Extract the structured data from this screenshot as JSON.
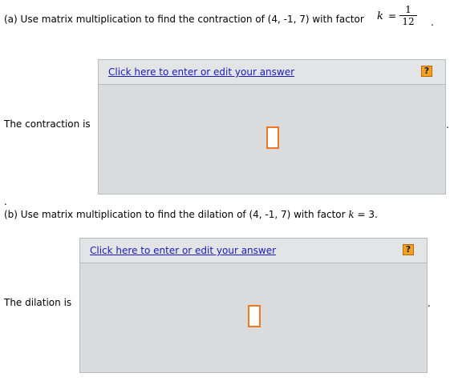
{
  "part_a": {
    "question": "(a) Use matrix multiplication to find the contraction of (4, -1, 7) with factor",
    "k_var": "k",
    "equals": "=",
    "frac_num": "1",
    "frac_den": "12",
    "end_mark": ".",
    "answer_label": "The contraction is",
    "link_text": "Click here to enter or edit your answer",
    "help_icon_text": "?",
    "trailing_period": "."
  },
  "part_b": {
    "leading_dot": ".",
    "question_prefix": "(b) Use matrix multiplication to find the dilation of (4, -1, 7) with factor",
    "k_var": "k",
    "question_suffix": "= 3.",
    "answer_label": "The dilation is",
    "link_text": "Click here to enter or edit your answer",
    "help_icon_text": "?",
    "trailing_period": "."
  },
  "colors": {
    "panel_bg": "#d9dbdd",
    "link": "#1a1ab8",
    "help_icon": "#f2a21b",
    "answer_box_border": "#f07820"
  }
}
